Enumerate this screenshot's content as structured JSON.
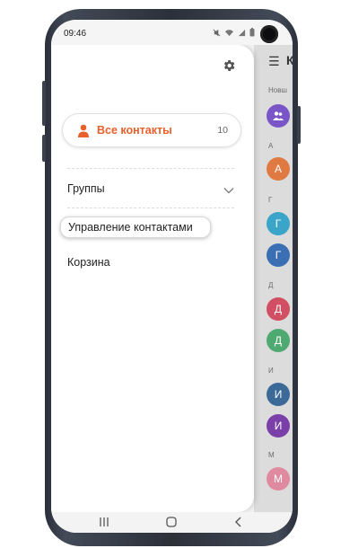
{
  "status_bar": {
    "time": "09:46",
    "icons": [
      "mute-icon",
      "wifi-icon",
      "signal-icon",
      "battery-icon"
    ]
  },
  "drawer": {
    "settings_icon": "gear-icon",
    "all_contacts": {
      "label": "Все контакты",
      "count": "10",
      "icon": "person-icon",
      "color": "#e8602c"
    },
    "groups_label": "Группы",
    "groups_chevron": "chevron-down-icon",
    "manage_label": "Управление контактами",
    "trash_label": "Корзина"
  },
  "background_list": {
    "title": "К",
    "new_section": "Новш",
    "sections": [
      {
        "letter": "А",
        "avatars": [
          {
            "initial": "А",
            "color": "#e07a42"
          }
        ]
      },
      {
        "letter": "Г",
        "avatars": [
          {
            "initial": "Г",
            "color": "#3aa5c9"
          },
          {
            "initial": "Г",
            "color": "#3a6fb4"
          }
        ]
      },
      {
        "letter": "Д",
        "avatars": [
          {
            "initial": "Д",
            "color": "#d24e62"
          },
          {
            "initial": "Д",
            "color": "#4faa72"
          }
        ]
      },
      {
        "letter": "И",
        "avatars": [
          {
            "initial": "И",
            "color": "#3b6a98"
          },
          {
            "initial": "И",
            "color": "#7a3fa8"
          }
        ]
      },
      {
        "letter": "М",
        "avatars": [
          {
            "initial": "М",
            "color": "#e08aa0"
          }
        ]
      }
    ],
    "group_avatar_color": "#7a55c8"
  },
  "nav_bar": {
    "recents_icon": "recents-icon",
    "home_icon": "home-icon",
    "back_icon": "back-icon"
  }
}
